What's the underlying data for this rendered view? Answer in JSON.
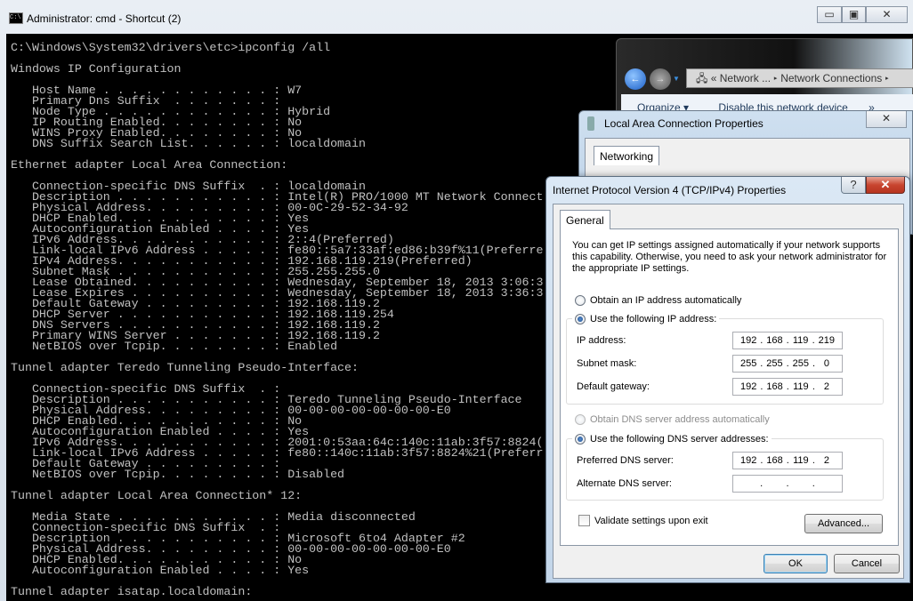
{
  "cmd": {
    "title": "Administrator: cmd - Shortcut (2)",
    "icon": "cmd-icon",
    "lines": [
      "C:\\Windows\\System32\\drivers\\etc>ipconfig /all",
      "",
      "Windows IP Configuration",
      "",
      "   Host Name . . . . . . . . . . . . : W7",
      "   Primary Dns Suffix  . . . . . . . :",
      "   Node Type . . . . . . . . . . . . : Hybrid",
      "   IP Routing Enabled. . . . . . . . : No",
      "   WINS Proxy Enabled. . . . . . . . : No",
      "   DNS Suffix Search List. . . . . . : localdomain",
      "",
      "Ethernet adapter Local Area Connection:",
      "",
      "   Connection-specific DNS Suffix  . : localdomain",
      "   Description . . . . . . . . . . . : Intel(R) PRO/1000 MT Network Connect",
      "   Physical Address. . . . . . . . . : 00-0C-29-52-34-92",
      "   DHCP Enabled. . . . . . . . . . . : Yes",
      "   Autoconfiguration Enabled . . . . : Yes",
      "   IPv6 Address. . . . . . . . . . . : 2::4(Preferred)",
      "   Link-local IPv6 Address . . . . . : fe80::5a7:33af:ed86:b39f%11(Preferre",
      "   IPv4 Address. . . . . . . . . . . : 192.168.119.219(Preferred)",
      "   Subnet Mask . . . . . . . . . . . : 255.255.255.0",
      "   Lease Obtained. . . . . . . . . . : Wednesday, September 18, 2013 3:06:3",
      "   Lease Expires . . . . . . . . . . : Wednesday, September 18, 2013 3:36:3",
      "   Default Gateway . . . . . . . . . : 192.168.119.2",
      "   DHCP Server . . . . . . . . . . . : 192.168.119.254",
      "   DNS Servers . . . . . . . . . . . : 192.168.119.2",
      "   Primary WINS Server . . . . . . . : 192.168.119.2",
      "   NetBIOS over Tcpip. . . . . . . . : Enabled",
      "",
      "Tunnel adapter Teredo Tunneling Pseudo-Interface:",
      "",
      "   Connection-specific DNS Suffix  . :",
      "   Description . . . . . . . . . . . : Teredo Tunneling Pseudo-Interface",
      "   Physical Address. . . . . . . . . : 00-00-00-00-00-00-00-E0",
      "   DHCP Enabled. . . . . . . . . . . : No",
      "   Autoconfiguration Enabled . . . . : Yes",
      "   IPv6 Address. . . . . . . . . . . : 2001:0:53aa:64c:140c:11ab:3f57:8824(",
      "   Link-local IPv6 Address . . . . . : fe80::140c:11ab:3f57:8824%21(Preferr",
      "   Default Gateway . . . . . . . . . :",
      "   NetBIOS over Tcpip. . . . . . . . : Disabled",
      "",
      "Tunnel adapter Local Area Connection* 12:",
      "",
      "   Media State . . . . . . . . . . . : Media disconnected",
      "   Connection-specific DNS Suffix  . :",
      "   Description . . . . . . . . . . . : Microsoft 6to4 Adapter #2",
      "   Physical Address. . . . . . . . . : 00-00-00-00-00-00-00-E0",
      "   DHCP Enabled. . . . . . . . . . . : No",
      "   Autoconfiguration Enabled . . . . : Yes",
      "",
      "Tunnel adapter isatap.localdomain:"
    ]
  },
  "explorer": {
    "breadcrumb": [
      "Network ...",
      "Network Connections"
    ],
    "toolbar": [
      "Organize ▾",
      "Disable this network device",
      "»"
    ]
  },
  "lac_dialog": {
    "title": "Local Area Connection Properties",
    "tab": "Networking"
  },
  "ipv4_dialog": {
    "title": "Internet Protocol Version 4 (TCP/IPv4) Properties",
    "help": "?",
    "close": "✕",
    "tab": "General",
    "intro": "You can get IP settings assigned automatically if your network supports this capability. Otherwise, you need to ask your network administrator for the appropriate IP settings.",
    "obtain_ip_auto": "Obtain an IP address automatically",
    "use_ip": "Use the following IP address:",
    "ip_label": "IP address:",
    "ip_value": [
      "192",
      "168",
      "119",
      "219"
    ],
    "subnet_label": "Subnet mask:",
    "subnet_value": [
      "255",
      "255",
      "255",
      "0"
    ],
    "gateway_label": "Default gateway:",
    "gateway_value": [
      "192",
      "168",
      "119",
      "2"
    ],
    "obtain_dns_auto": "Obtain DNS server address automatically",
    "use_dns": "Use the following DNS server addresses:",
    "pref_dns_label": "Preferred DNS server:",
    "pref_dns_value": [
      "192",
      "168",
      "119",
      "2"
    ],
    "alt_dns_label": "Alternate DNS server:",
    "alt_dns_value": [
      "",
      "",
      "",
      ""
    ],
    "validate": "Validate settings upon exit",
    "validate_checked": false,
    "advanced": "Advanced...",
    "ok": "OK",
    "cancel": "Cancel"
  }
}
